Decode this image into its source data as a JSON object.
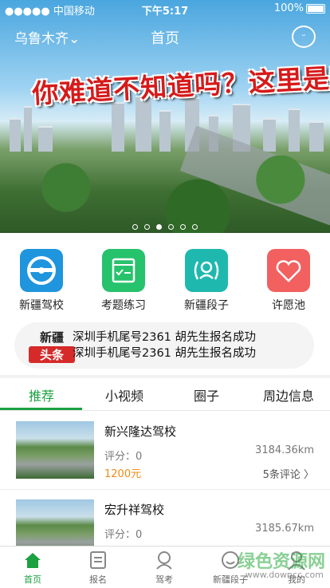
{
  "status_bar": {
    "carrier": "●●●●● 中国移动",
    "time": "下午5:17",
    "battery": "100%"
  },
  "nav": {
    "city": "乌鲁木齐",
    "title": "首页"
  },
  "banner": {
    "slogan": "你难道不知道吗？这里是新疆",
    "dot_count": 6,
    "active_dot": 2
  },
  "quick_links": [
    {
      "label": "新疆驾校",
      "color": "#1f95dd"
    },
    {
      "label": "考题练习",
      "color": "#27c26c"
    },
    {
      "label": "新疆段子",
      "color": "#1fb8ae"
    },
    {
      "label": "许愿池",
      "color": "#f26060"
    }
  ],
  "news": {
    "badge_top": "新疆",
    "badge_bottom": "头条",
    "lines": [
      "深圳手机尾号2361 胡先生报名成功",
      "深圳手机尾号2361 胡先生报名成功"
    ]
  },
  "tabs": [
    "推荐",
    "小视频",
    "圈子",
    "周边信息"
  ],
  "schools": [
    {
      "name": "新兴隆达驾校",
      "score": "评分：0",
      "price": "1200元",
      "distance": "3184.36km",
      "comments": "5条评论"
    },
    {
      "name": "宏升祥驾校",
      "score": "评分：0",
      "price": "",
      "distance": "3185.67km",
      "comments": ""
    }
  ],
  "tabbar": [
    "首页",
    "报名",
    "驾考",
    "新疆段子",
    "我的"
  ],
  "watermark": {
    "text": "绿色资源网",
    "url": "www.downcc.com"
  },
  "colors": {
    "accent": "#1aa140",
    "price": "#f08a14",
    "badge": "#d62a2a"
  }
}
